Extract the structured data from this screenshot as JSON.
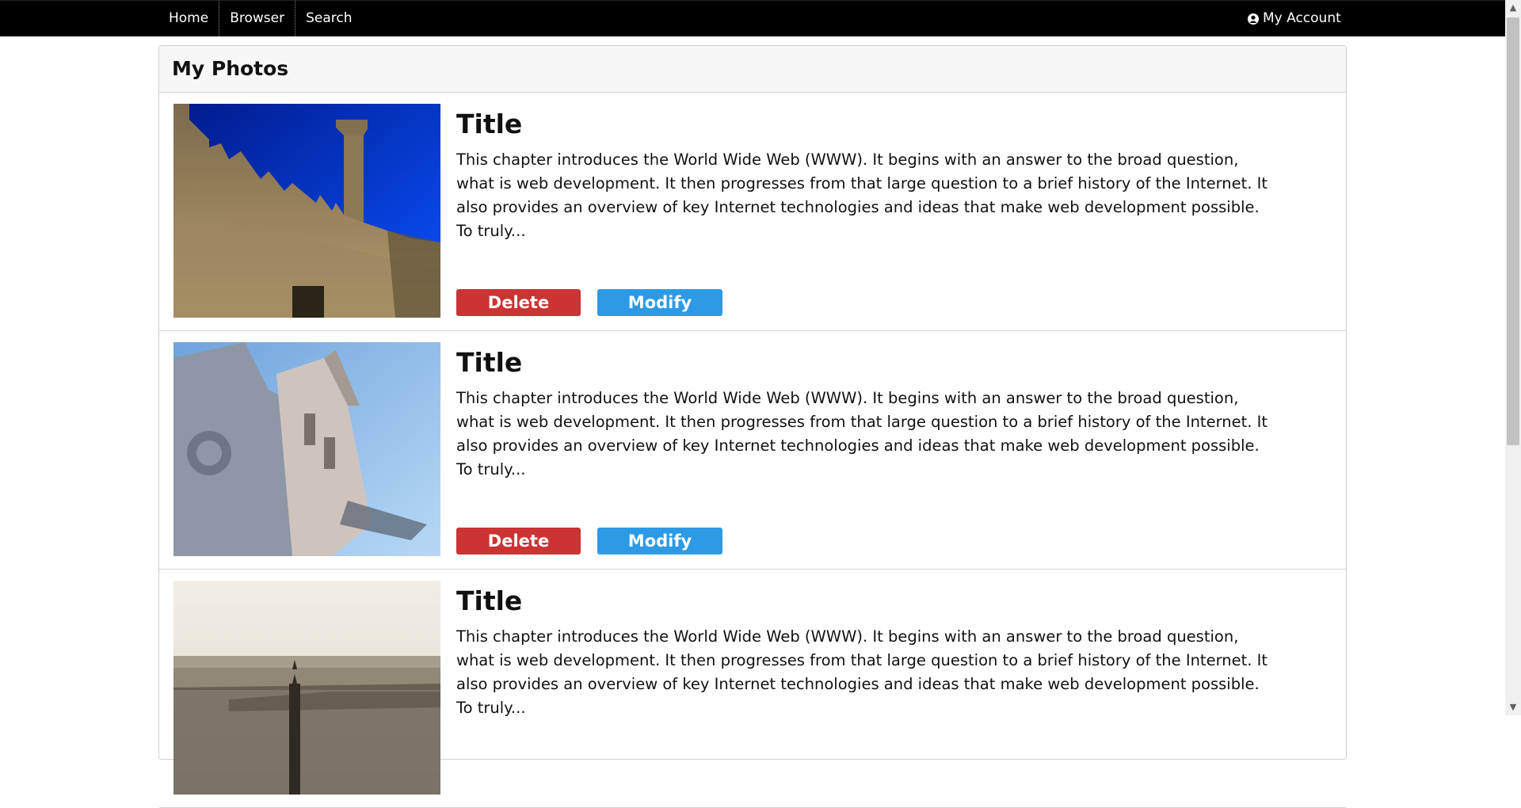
{
  "nav": {
    "items": [
      "Home",
      "Browser",
      "Search"
    ],
    "account_label": "My Account"
  },
  "panel": {
    "title": "My Photos"
  },
  "photos": [
    {
      "title": "Title",
      "description": "This chapter introduces the World Wide Web (WWW). It begins with an answer to the broad question, what is web development. It then progresses from that large question to a brief history of the Internet. It also provides an overview of key Internet technologies and ideas that make web development possible. To truly...",
      "delete_label": "Delete",
      "modify_label": "Modify"
    },
    {
      "title": "Title",
      "description": "This chapter introduces the World Wide Web (WWW). It begins with an answer to the broad question, what is web development. It then progresses from that large question to a brief history of the Internet. It also provides an overview of key Internet technologies and ideas that make web development possible. To truly...",
      "delete_label": "Delete",
      "modify_label": "Modify"
    },
    {
      "title": "Title",
      "description": "This chapter introduces the World Wide Web (WWW). It begins with an answer to the broad question, what is web development. It then progresses from that large question to a brief history of the Internet. It also provides an overview of key Internet technologies and ideas that make web development possible. To truly..."
    }
  ],
  "colors": {
    "nav_bg": "#000000",
    "delete_button": "#cc3333",
    "modify_button": "#2d9ae6"
  },
  "icons": {
    "account": "user-icon"
  }
}
